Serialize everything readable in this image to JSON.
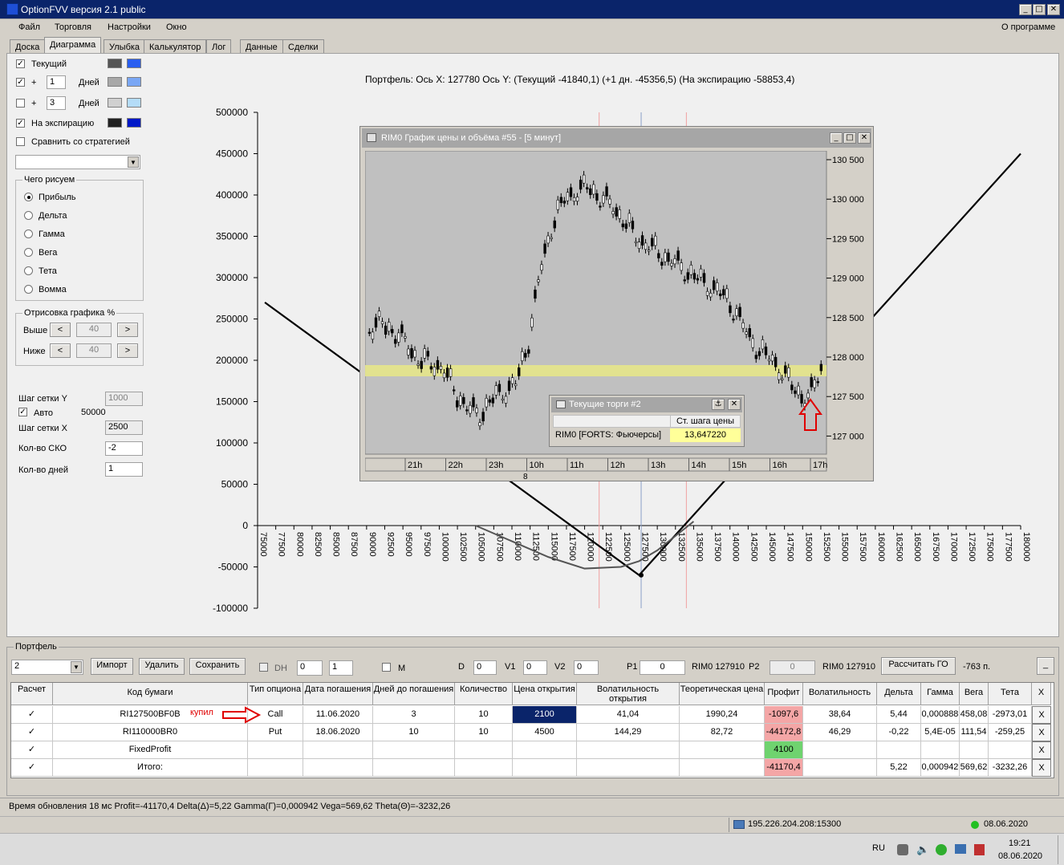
{
  "window": {
    "title": "OptionFVV версия 2.1 public",
    "min": "_",
    "max": "□",
    "close": "✕"
  },
  "menu": {
    "items": [
      "Файл",
      "Торговля",
      "Настройки",
      "Окно"
    ],
    "about": "О программе"
  },
  "tabs": [
    "Доска",
    "Диаграмма",
    "Улыбка",
    "Калькулятор",
    "Лог",
    "Данные",
    "Сделки"
  ],
  "left": {
    "current_label": "Текущий",
    "plus_label": "+",
    "days_label": "Дней",
    "days1": "1",
    "days2": "3",
    "expiry_label": "На экспирацию",
    "compare_label": "Сравнить со стратегией",
    "what_group": "Чего рисуем",
    "radios": [
      "Прибыль",
      "Дельта",
      "Гамма",
      "Вега",
      "Тета",
      "Вомма"
    ],
    "draw_group": "Отрисовка графика %",
    "above_label": "Выше",
    "below_label": "Ниже",
    "above_value": "40",
    "below_value": "40",
    "arrow_left": "<",
    "arrow_right": ">",
    "grid_y_label": "Шаг сетки Y",
    "grid_y_value": "1000",
    "auto_label": "Авто",
    "auto_value": "50000",
    "grid_x_label": "Шаг сетки X",
    "grid_x_value": "2500",
    "sko_label": "Кол-во СКО",
    "sko_value": "-2",
    "days_count_label": "Кол-во дней",
    "days_count_value": "1"
  },
  "chart_header": {
    "prefix": "Портфель:",
    "axis_x_label": "Ось X:",
    "axis_x_value": "127780",
    "axis_y_label": "Ось Y:",
    "current": "(Текущий -41840,1)",
    "plus_day": "(+1 дн. -45356,5)",
    "expiry": "(На экспирацию -58853,4)"
  },
  "chart_data": {
    "type": "line",
    "y_ticks": [
      "500000",
      "450000",
      "400000",
      "350000",
      "300000",
      "250000",
      "200000",
      "150000",
      "100000",
      "50000",
      "0",
      "-50000",
      "-100000"
    ],
    "x_ticks": [
      "75000",
      "77500",
      "80000",
      "82500",
      "85000",
      "87500",
      "90000",
      "92500",
      "95000",
      "97500",
      "100000",
      "102500",
      "105000",
      "107500",
      "110000",
      "112500",
      "115000",
      "117500",
      "120000",
      "122500",
      "125000",
      "127500",
      "130000",
      "132500",
      "135000",
      "137500",
      "140000",
      "142500",
      "145000",
      "147500",
      "150000",
      "152500",
      "155000",
      "157500",
      "160000",
      "162500",
      "165000",
      "167500",
      "170000",
      "172500",
      "175000",
      "177500",
      "180000"
    ],
    "ylim": [
      -100000,
      500000
    ],
    "xlim": [
      75000,
      180000
    ],
    "series": [
      {
        "name": "На экспирацию",
        "color": "#000000",
        "x": [
          76000,
          127500,
          180000
        ],
        "y": [
          270000,
          -60000,
          450000
        ]
      },
      {
        "name": "Текущий",
        "color": "#555555",
        "x": [
          105000,
          115000,
          120000,
          125000,
          127500,
          130000,
          135000
        ],
        "y": [
          0,
          -38000,
          -52000,
          -50000,
          -43000,
          -30000,
          5000
        ]
      }
    ],
    "cursor_x": 127780
  },
  "inner_window": {
    "title": "RIM0 График цены и объёма #55 - [5 минут]",
    "price_ticks": [
      "130 500",
      "130 000",
      "129 500",
      "129 000",
      "128 500",
      "128 000",
      "127 500",
      "127 000"
    ],
    "time_ticks": [
      "21h",
      "22h",
      "23h",
      "10h",
      "11h",
      "12h",
      "13h",
      "14h",
      "15h",
      "16h",
      "17h"
    ],
    "date_label": "8"
  },
  "small_window": {
    "title": "Текущие торги #2",
    "header": "Ст. шага цены",
    "instrument": "RIM0 [FORTS: Фьючерсы]",
    "value": "13,647220"
  },
  "portfolio": {
    "label": "Портфель",
    "selected": "2",
    "import": "Импорт",
    "delete": "Удалить",
    "save": "Сохранить",
    "dh": "DH",
    "dh_val": "0",
    "dh_val2": "1",
    "m": "M",
    "d": "D",
    "d_val": "0",
    "v1": "V1",
    "v1_val": "0",
    "v2": "V2",
    "v2_val": "0",
    "p1": "P1",
    "p1_val": "0",
    "rim1": "RIM0 127910",
    "p2": "P2",
    "p2_val": "0",
    "rim2": "RIM0 127910",
    "go_button": "Рассчитать ГО",
    "go_value": "-763 п.",
    "underscore": "_"
  },
  "table": {
    "headers": [
      "Расчет",
      "Код бумаги",
      "Тип опциона",
      "Дата погашения",
      "Дней до погашения",
      "Количество",
      "Цена открытия",
      "Волатильность открытия",
      "Теоретическая цена",
      "Профит",
      "Волатильность",
      "Дельта",
      "Гамма",
      "Вега",
      "Тета",
      "X"
    ],
    "rows": [
      [
        "✓",
        "RI127500BF0B",
        "Call",
        "11.06.2020",
        "3",
        "10",
        "2100",
        "41,04",
        "1990,24",
        "-1097,6",
        "38,64",
        "5,44",
        "0,000888",
        "458,08",
        "-2973,01",
        "X"
      ],
      [
        "✓",
        "RI110000BR0",
        "Put",
        "18.06.2020",
        "10",
        "10",
        "4500",
        "144,29",
        "82,72",
        "-44172,8",
        "46,29",
        "-0,22",
        "5,4E-05",
        "111,54",
        "-259,25",
        "X"
      ],
      [
        "✓",
        "FixedProfit",
        "",
        "",
        "",
        "",
        "",
        "",
        "",
        "4100",
        "",
        "",
        "",
        "",
        "",
        "X"
      ],
      [
        "✓",
        "Итого:",
        "",
        "",
        "",
        "",
        "",
        "",
        "",
        "-41170,4",
        "",
        "5,22",
        "0,000942",
        "569,62",
        "-3232,26",
        "X"
      ]
    ],
    "annotation": "купил"
  },
  "status": {
    "text": "Время обновления 18 мс  Profit=-41170,4 Delta(Δ)=5,22 Gamma(Γ)=0,000942 Vega=569,62 Theta(Θ)=-3232,26",
    "server": "195.226.204.208:15300",
    "date": "08.06.2020"
  },
  "taskbar": {
    "lang": "RU",
    "time": "19:21",
    "date": "08.06.2020"
  },
  "colors": {
    "accent": "#2a4fe0",
    "profit_neg": "#f4a6a6",
    "profit_pos": "#6fd36f",
    "selected_cell": "#0a246a",
    "band": "#e6e68a"
  }
}
